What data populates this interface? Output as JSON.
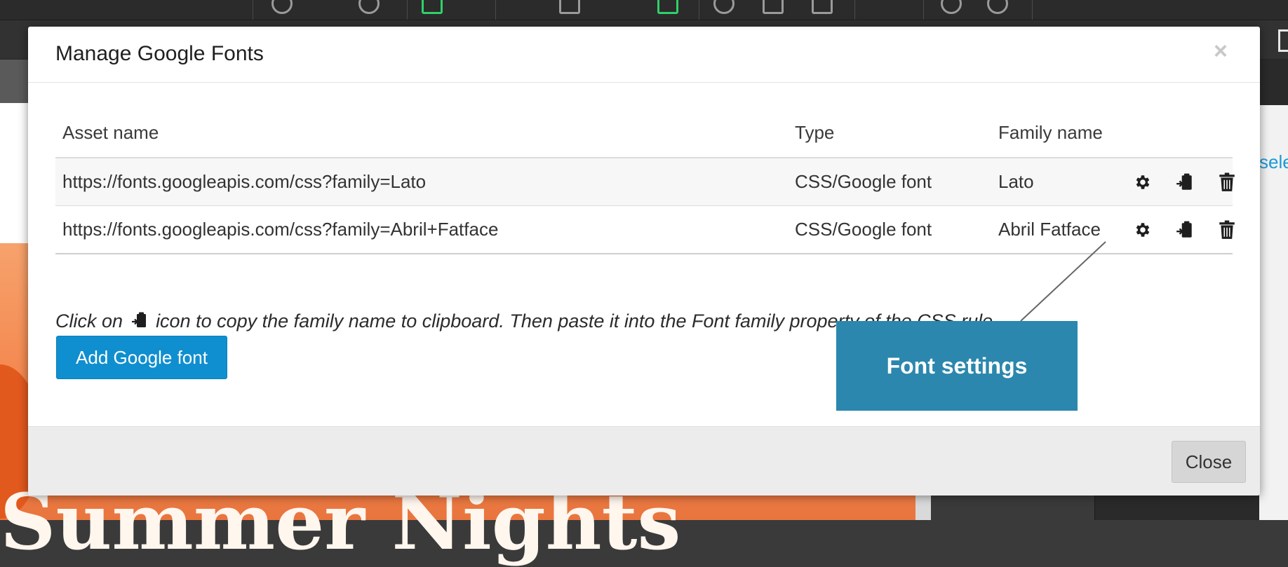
{
  "background": {
    "poster_title": "Summer Nights",
    "side_link": "sele"
  },
  "modal": {
    "title": "Manage Google Fonts",
    "close_x": "×",
    "table": {
      "headers": {
        "asset": "Asset name",
        "type": "Type",
        "family": "Family name"
      },
      "rows": [
        {
          "asset": "https://fonts.googleapis.com/css?family=Lato",
          "type": "CSS/Google font",
          "family": "Lato"
        },
        {
          "asset": "https://fonts.googleapis.com/css?family=Abril+Fatface",
          "type": "CSS/Google font",
          "family": "Abril Fatface"
        }
      ],
      "row_actions": [
        "gear-icon",
        "copy-to-clipboard-icon",
        "trash-icon"
      ]
    },
    "hint": {
      "before": "Click on",
      "after": "icon to copy the family name to clipboard. Then paste it into the Font family property of the CSS rule."
    },
    "add_button": "Add Google font",
    "footer_close": "Close"
  },
  "callout": {
    "label": "Font settings",
    "color": "#2b87ad"
  },
  "colors": {
    "primary_button": "#0f8fcf",
    "footer": "#ececec"
  }
}
